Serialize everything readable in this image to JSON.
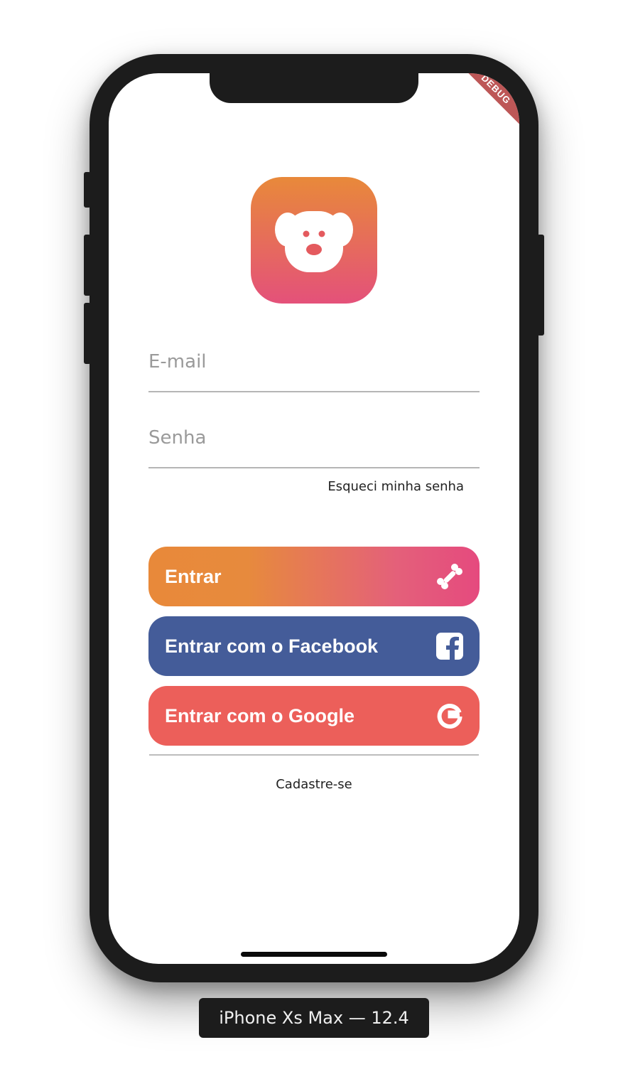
{
  "app": {
    "debug_banner": "DEBUG"
  },
  "login": {
    "email_placeholder": "E-mail",
    "password_placeholder": "Senha",
    "forgot_password": "Esqueci minha senha",
    "enter_label": "Entrar",
    "facebook_label": "Entrar com o Facebook",
    "google_label": "Entrar com o Google",
    "signup_label": "Cadastre-se"
  },
  "icons": {
    "logo": "dog-face-icon",
    "enter": "bone-icon",
    "facebook": "facebook-icon",
    "google": "google-icon"
  },
  "colors": {
    "gradient_start": "#e8893a",
    "gradient_end": "#e4517a",
    "facebook": "#445c99",
    "google": "#ec5f5a"
  },
  "simulator": {
    "device_label": "iPhone Xs Max — 12.4"
  }
}
